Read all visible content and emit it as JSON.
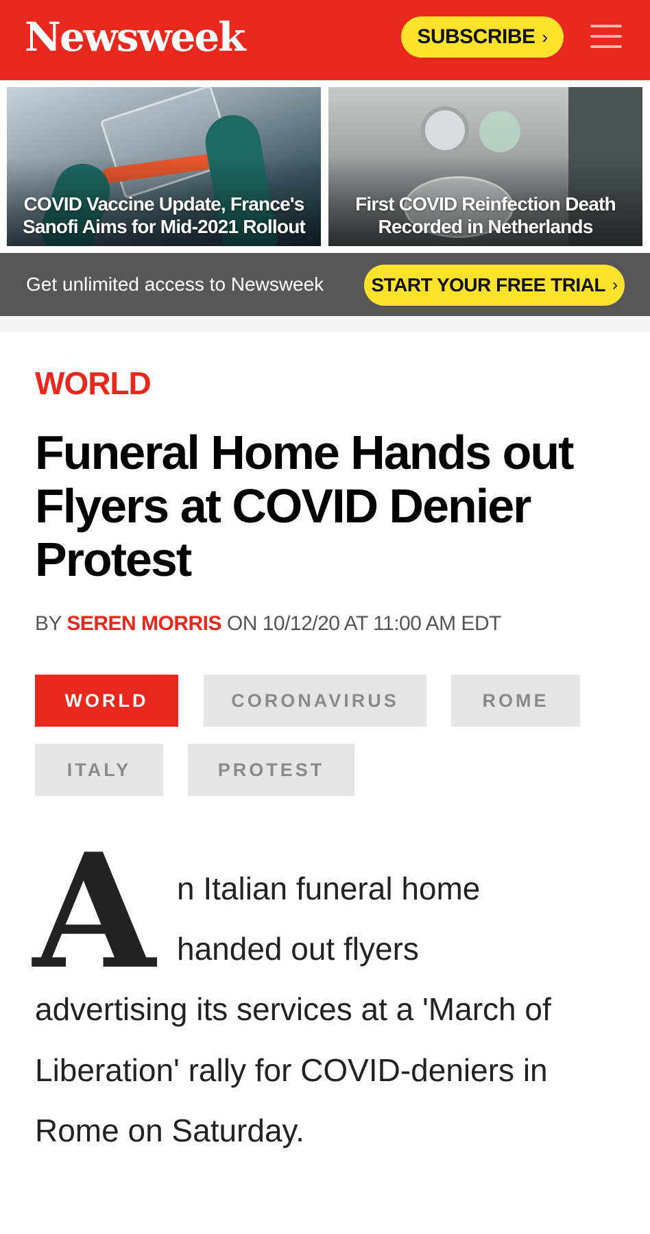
{
  "header": {
    "logo": "Newsweek",
    "subscribe_label": "SUBSCRIBE",
    "subscribe_chevron": "›",
    "menu_icon": "hamburger-menu-icon",
    "colors": {
      "brand_red": "#e9281d",
      "cta_yellow": "#ffe22b"
    }
  },
  "promo": {
    "cards": [
      {
        "title": "COVID Vaccine Update, France's Sanofi Aims for Mid-2021 Rollout"
      },
      {
        "title": "First COVID Reinfection Death Recorded in Netherlands"
      }
    ]
  },
  "trial": {
    "text": "Get unlimited access to Newsweek",
    "button_label": "START YOUR FREE TRIAL",
    "button_chevron": "›"
  },
  "article": {
    "category": "WORLD",
    "headline_lines": [
      "Funeral Home Hands out",
      "Flyers at COVID Denier",
      "Protest"
    ],
    "byline": {
      "prefix": "BY",
      "author": "SEREN MORRIS",
      "date_text": "ON 10/12/20 AT 11:00 AM EDT"
    },
    "tags": [
      "WORLD",
      "CORONAVIRUS",
      "ROME",
      "ITALY",
      "PROTEST"
    ],
    "drop_cap": "A",
    "body_lines": [
      "n Italian funeral home",
      "handed out flyers",
      "advertising its services at a 'March of",
      "Liberation' rally for COVID-deniers in",
      "Rome on Saturday."
    ]
  }
}
